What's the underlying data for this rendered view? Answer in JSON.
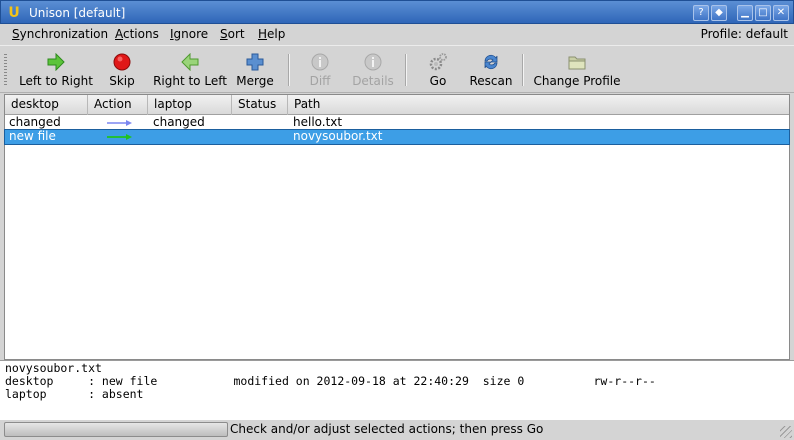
{
  "window": {
    "app_icon": "unison-u-icon",
    "title": "Unison [default]",
    "buttons": [
      "help",
      "sticky",
      "minimize",
      "maximize",
      "close"
    ]
  },
  "menubar": {
    "items": [
      {
        "first": "S",
        "rest": "ynchronization"
      },
      {
        "first": "A",
        "rest": "ctions"
      },
      {
        "first": "I",
        "rest": "gnore"
      },
      {
        "first": "S",
        "rest": "ort"
      },
      {
        "first": "H",
        "rest": "elp"
      }
    ],
    "profile": "Profile: default"
  },
  "toolbar": {
    "left_to_right": "Left to Right",
    "skip": "Skip",
    "right_to_left": "Right to Left",
    "merge": "Merge",
    "diff": "Diff",
    "details": "Details",
    "go": "Go",
    "rescan": "Rescan",
    "change_profile": "Change Profile"
  },
  "table": {
    "columns": [
      "desktop",
      "Action",
      "laptop",
      "Status",
      "Path"
    ],
    "rows": [
      {
        "desktop": "changed",
        "action": "right-arrow",
        "action_color": "#7b86f0",
        "laptop": "changed",
        "status": "",
        "path": "hello.txt"
      },
      {
        "desktop": "new file",
        "action": "right-arrow",
        "action_color": "#1fc21f",
        "laptop": "",
        "status": "",
        "path": "novysoubor.txt"
      }
    ]
  },
  "details": {
    "line1": "novysoubor.txt",
    "line2": "desktop     : new file           modified on 2012-09-18 at 22:40:29  size 0          rw-r--r--",
    "line3": "laptop      : absent"
  },
  "statusbar": {
    "text": "Check and/or adjust selected actions; then press Go"
  },
  "colors": {
    "selection": "#3d9ee6",
    "titlebar": "#2f66b8"
  }
}
